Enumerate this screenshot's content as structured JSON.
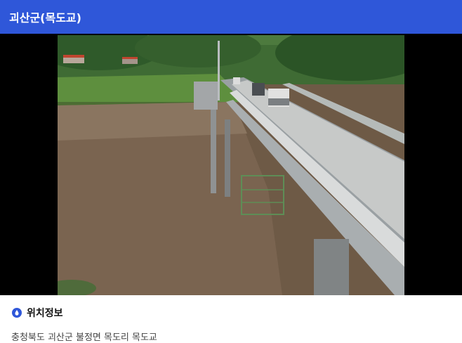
{
  "header": {
    "title": "괴산군(목도교)"
  },
  "viewer": {
    "stream_icon": "cctv-video-frame"
  },
  "location": {
    "icon": "water-drop-icon",
    "title": "위치정보",
    "address": "충청북도 괴산군 불정면 목도리 목도교"
  },
  "colors": {
    "header_bg": "#2f57d9",
    "viewer_bg": "#000000",
    "icon_accent": "#2f57d9"
  }
}
